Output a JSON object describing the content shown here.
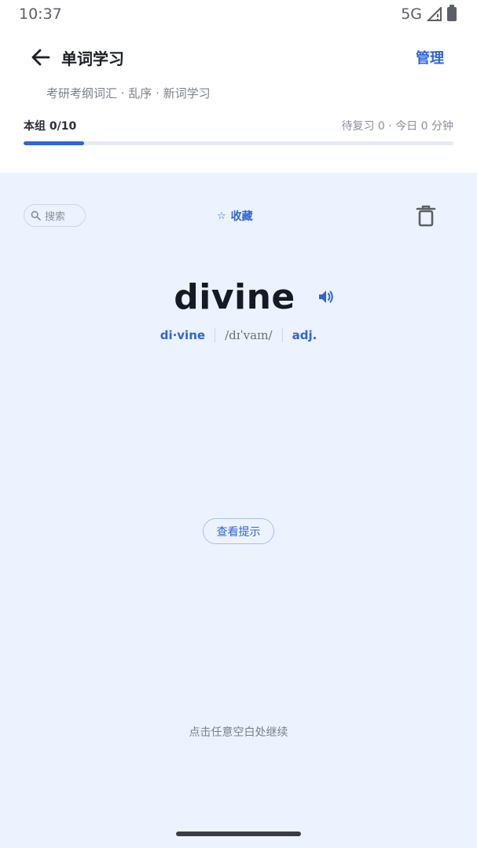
{
  "status_bar": {
    "time": "10:37",
    "network": "5G"
  },
  "header": {
    "title": "单词学习",
    "manage_label": "管理"
  },
  "subtitle": "考研考纲词汇 · 乱序 · 新词学习",
  "progress": {
    "group_label": "本组 0/10",
    "stats": "待复习 0  ·  今日 0 分钟",
    "fill_fraction": 0.14
  },
  "card": {
    "search_placeholder": "搜索",
    "favorite_label": "收藏",
    "word": "divine",
    "syllables": "di·vine",
    "phonetic": "/dɪˈvaɪn/",
    "pos": "adj.",
    "hint_label": "查看提示",
    "continue_text": "点击任意空白处继续"
  },
  "colors": {
    "accent": "#2f65d8",
    "card_bg": "#edf3fe"
  }
}
